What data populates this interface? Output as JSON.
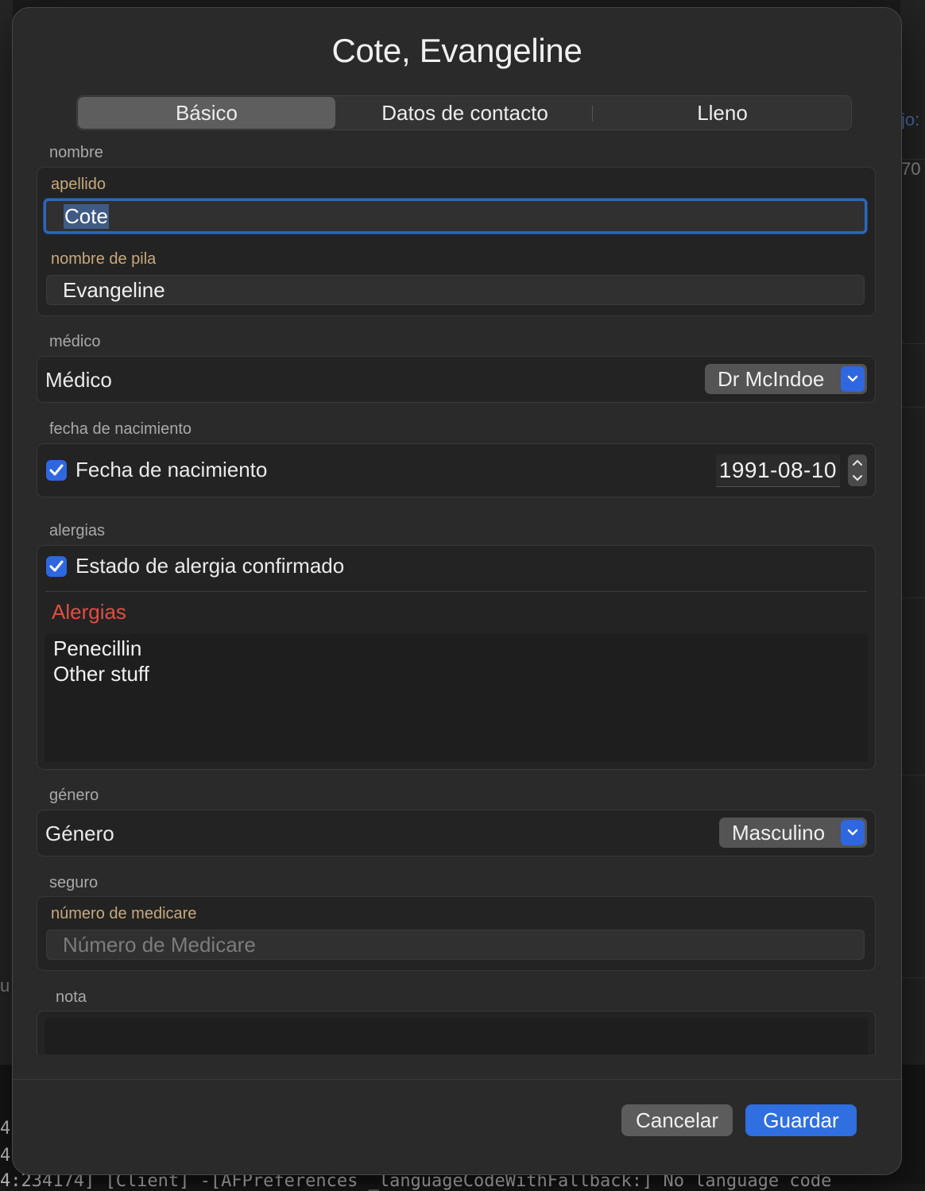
{
  "background": {
    "fragment_right_top": "jo:",
    "fragment_right_mid": "70",
    "fragment_left": "u",
    "log_line_1": "4",
    "log_line_2": "4",
    "log_line_bottom": "4:234174] [Client] -[AFPreferences _languageCodeWithFallback:] No language code"
  },
  "sheet": {
    "title": "Cote, Evangeline",
    "tabs": [
      {
        "label": "Básico",
        "active": true
      },
      {
        "label": "Datos de contacto",
        "active": false
      },
      {
        "label": "Lleno",
        "active": false
      }
    ]
  },
  "sections": {
    "name": {
      "label": "nombre",
      "surname_label": "apellido",
      "surname_value": "Cote",
      "given_label": "nombre de pila",
      "given_value": "Evangeline"
    },
    "doctor": {
      "label": "médico",
      "row_label": "Médico",
      "selected": "Dr McIndoe"
    },
    "dob": {
      "label": "fecha de nacimiento",
      "checkbox_label": "Fecha de nacimiento",
      "checked": true,
      "value": "1991-08-10"
    },
    "allergies": {
      "label": "alergias",
      "checkbox_label": "Estado de alergia confirmado",
      "checked": true,
      "list_label": "Alergias",
      "lines": [
        "Penecillin",
        "Other stuff"
      ]
    },
    "gender": {
      "label": "género",
      "row_label": "Género",
      "selected": "Masculino"
    },
    "insurance": {
      "label": "seguro",
      "field_label": "número de medicare",
      "placeholder": "Número de Medicare"
    },
    "note": {
      "label": "nota"
    }
  },
  "buttons": {
    "cancel": "Cancelar",
    "save": "Guardar"
  },
  "colors": {
    "accent": "#2f67e0",
    "field_label": "#c8a97c",
    "alert_label": "#e24e41"
  }
}
